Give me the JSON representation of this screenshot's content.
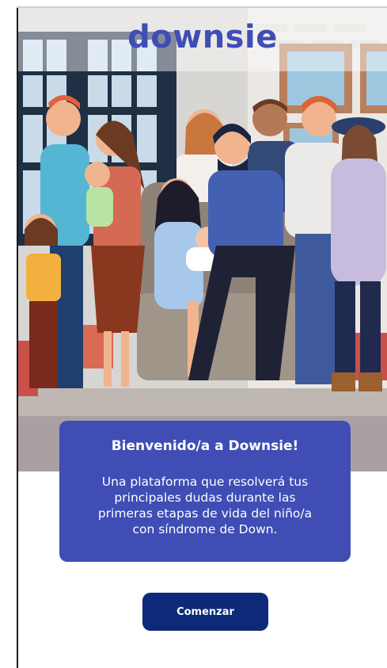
{
  "brand": {
    "logo_text": "downsie",
    "logo_color": "#3f4db5"
  },
  "welcome": {
    "title": "Bienvenido/a a Downsie!",
    "body": "Una plataforma que resolverá tus principales dudas durante las primeras etapas de vida del niño/a con síndrome de Down."
  },
  "actions": {
    "start_label": "Comenzar"
  },
  "colors": {
    "card_bg": "#3f4db5",
    "button_bg": "#0d2a7a"
  },
  "illustration": {
    "icon": "family-group-illustration"
  }
}
